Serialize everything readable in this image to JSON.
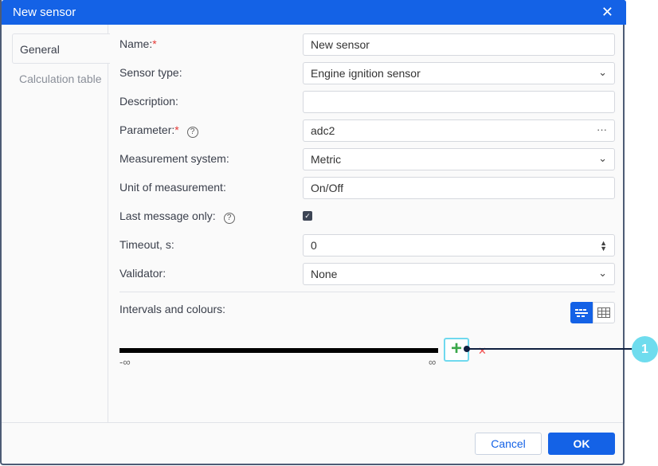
{
  "title": "New sensor",
  "tabs": [
    "General",
    "Calculation table"
  ],
  "fields": {
    "name": {
      "label": "Name:",
      "value": "New sensor"
    },
    "sensor_type": {
      "label": "Sensor type:",
      "value": "Engine ignition sensor"
    },
    "description": {
      "label": "Description:",
      "value": ""
    },
    "parameter": {
      "label": "Parameter:",
      "value": "adc2"
    },
    "measurement": {
      "label": "Measurement system:",
      "value": "Metric"
    },
    "unit": {
      "label": "Unit of measurement:",
      "value": "On/Off"
    },
    "last_message": {
      "label": "Last message only:",
      "checked": true
    },
    "timeout": {
      "label": "Timeout, s:",
      "value": "0"
    },
    "validator": {
      "label": "Validator:",
      "value": "None"
    }
  },
  "intervals": {
    "label": "Intervals and colours:",
    "min": "-∞",
    "max": "∞"
  },
  "callout": "1",
  "buttons": {
    "cancel": "Cancel",
    "ok": "OK"
  },
  "colors": {
    "accent": "#1462e6",
    "callout": "#6fdcee"
  }
}
